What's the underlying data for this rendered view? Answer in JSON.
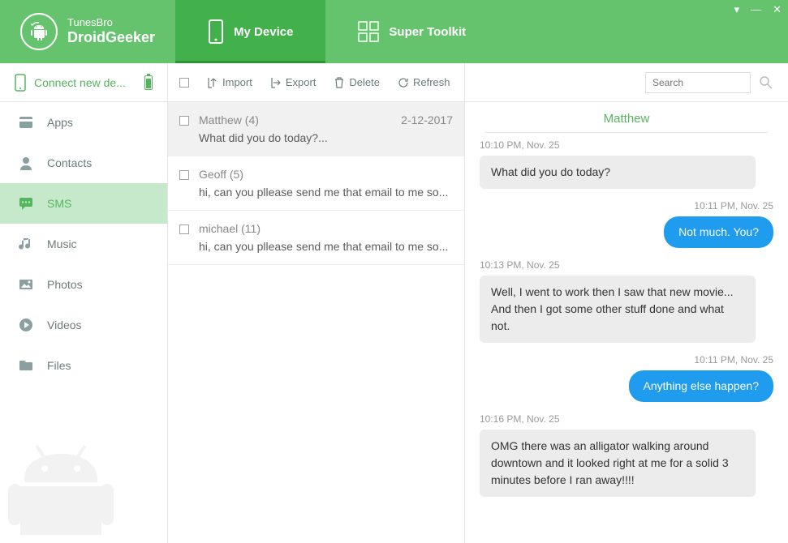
{
  "brand": {
    "top": "TunesBro",
    "bottom": "DroidGeeker"
  },
  "nav": {
    "device": "My Device",
    "toolkit": "Super Toolkit"
  },
  "connect": "Connect new de...",
  "sidebar": {
    "items": [
      {
        "label": "Apps"
      },
      {
        "label": "Contacts"
      },
      {
        "label": "SMS"
      },
      {
        "label": "Music"
      },
      {
        "label": "Photos"
      },
      {
        "label": "Videos"
      },
      {
        "label": "Files"
      }
    ]
  },
  "toolbar": {
    "import": "Import",
    "export": "Export",
    "delete": "Delete",
    "refresh": "Refresh"
  },
  "search": {
    "placeholder": "Search"
  },
  "conversations": [
    {
      "name": "Matthew (4)",
      "date": "2-12-2017",
      "preview": "What did you do today?..."
    },
    {
      "name": "Geoff (5)",
      "date": "",
      "preview": "hi, can you pllease send me that email to me so..."
    },
    {
      "name": "michael (11)",
      "date": "",
      "preview": "hi, can you pllease send me that email to me so..."
    }
  ],
  "chat": {
    "title": "Matthew",
    "messages": [
      {
        "time": "10:10 PM, Nov. 25",
        "dir": "in",
        "text": "What did you do today?"
      },
      {
        "time": "10:11 PM, Nov. 25",
        "dir": "out",
        "text": "Not much. You?"
      },
      {
        "time": "10:13 PM, Nov. 25",
        "dir": "in",
        "text": " Well, I went to work then I saw that new movie... And then I got some other stuff done and  what not."
      },
      {
        "time": "10:11 PM, Nov. 25",
        "dir": "out",
        "text": "Anything else happen?"
      },
      {
        "time": "10:16 PM, Nov. 25",
        "dir": "in",
        "text": "  OMG there was an alligator walking around downtown and it looked right at me for a solid 3 minutes before I ran away!!!!"
      }
    ]
  }
}
